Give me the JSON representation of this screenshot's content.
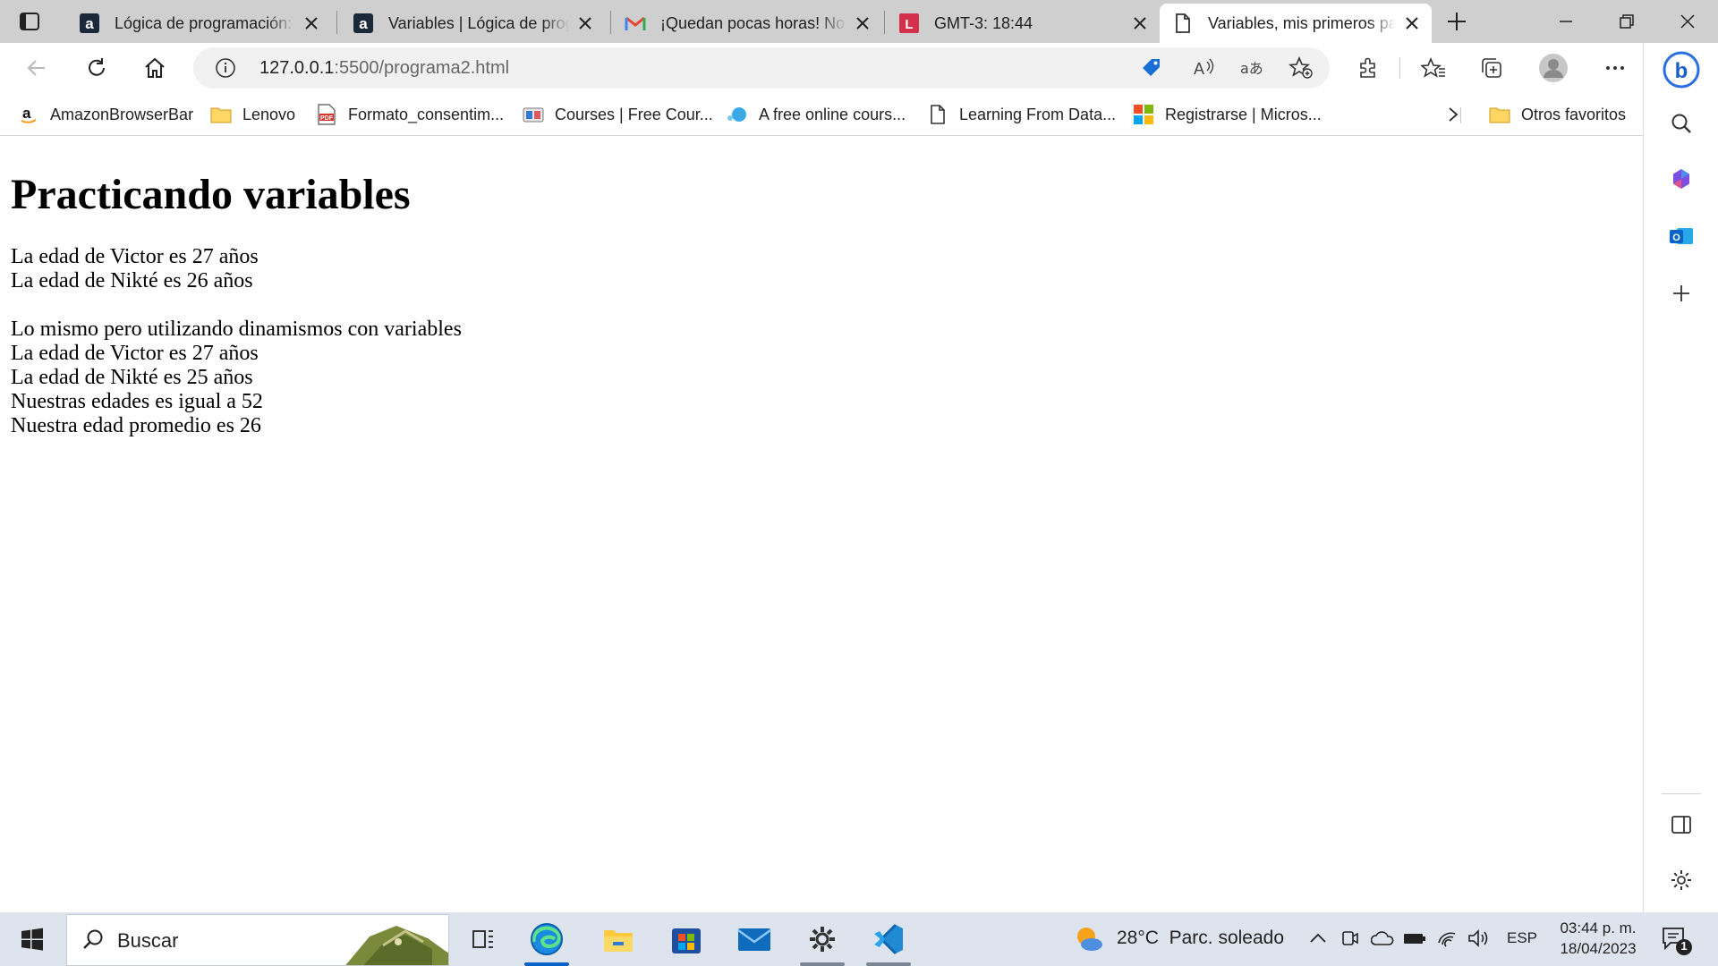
{
  "browser": {
    "tabs": [
      {
        "title": "Lógica de programación: Practicando lógica",
        "favicon": "alura-icon",
        "active": false
      },
      {
        "title": "Variables | Lógica de programación",
        "favicon": "alura-icon",
        "active": false
      },
      {
        "title": "¡Quedan pocas horas! No te lo pierdas",
        "favicon": "gmail-icon",
        "active": false
      },
      {
        "title": "GMT-3: 18:44",
        "favicon": "l-red-icon",
        "active": false
      },
      {
        "title": "Variables, mis primeros pasos",
        "favicon": "page-icon",
        "active": true
      }
    ],
    "url_host": "127.0.0.1",
    "url_rest": ":5500/programa2.html",
    "favorites": [
      {
        "label": "AmazonBrowserBar",
        "icon": "amazon-icon"
      },
      {
        "label": "Lenovo",
        "icon": "folder-icon"
      },
      {
        "label": "Formato_consentim...",
        "icon": "pdf-icon"
      },
      {
        "label": "Courses | Free Cour...",
        "icon": "courses-icon"
      },
      {
        "label": "A free online cours...",
        "icon": "blue-dot-icon"
      },
      {
        "label": "Learning From Data...",
        "icon": "page-icon"
      },
      {
        "label": "Registrarse | Micros...",
        "icon": "microsoft-icon"
      }
    ],
    "other_favorites": "Otros favoritos"
  },
  "page": {
    "heading": "Practicando variables",
    "lines": [
      "La edad de Victor es 27 años",
      "La edad de Nikté es 26 años",
      "",
      "Lo mismo pero utilizando dinamismos con variables",
      "La edad de Victor es 27 años",
      "La edad de Nikté es 25 años",
      "Nuestras edades es igual a 52",
      "Nuestra edad promedio es 26"
    ]
  },
  "taskbar": {
    "search_placeholder": "Buscar",
    "weather_temp": "28°C",
    "weather_desc": "Parc. soleado",
    "language": "ESP",
    "time": "03:44 p. m.",
    "date": "18/04/2023",
    "notification_count": "1"
  },
  "colors": {
    "accent": "#0a64c8",
    "tabstrip": "#cfcfcf",
    "taskbar": "#dde4ee"
  }
}
